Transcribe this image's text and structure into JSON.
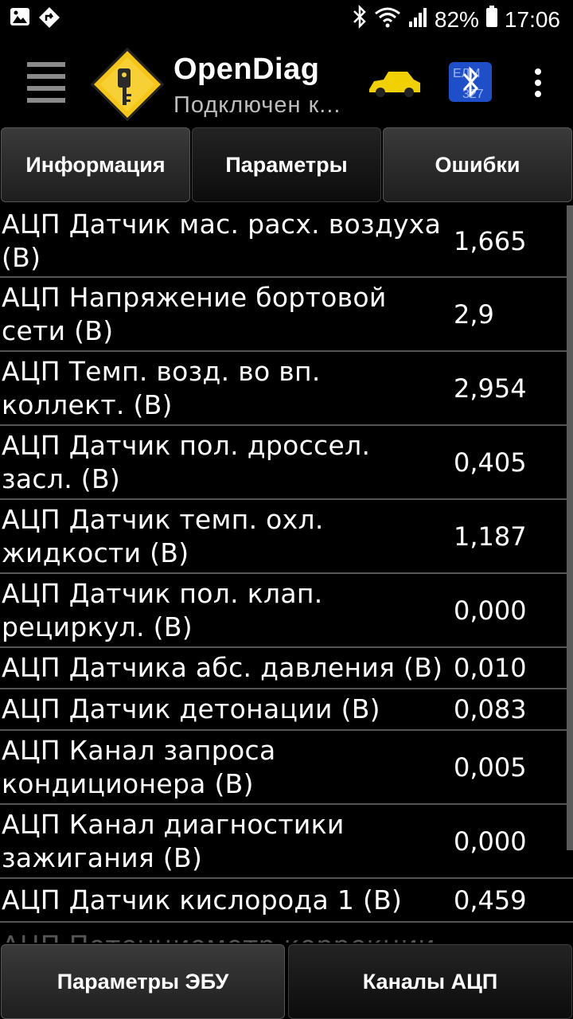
{
  "statusbar": {
    "battery": "82%",
    "time": "17:06",
    "icons": [
      "image-icon",
      "navigation-app-icon",
      "bluetooth-icon",
      "wifi-icon",
      "signal-icon",
      "battery-icon"
    ]
  },
  "appbar": {
    "title": "OpenDiag",
    "subtitle": "Подключен к...",
    "logo_color": "#f5c518",
    "car_color": "#f0d000",
    "bt_color": "#1e4fc8"
  },
  "tabs": [
    {
      "label": "Информация",
      "active": false
    },
    {
      "label": "Параметры",
      "active": true
    },
    {
      "label": "Ошибки",
      "active": false
    }
  ],
  "params": [
    {
      "label": "АЦП Датчик мас. расх. воздуха (В)",
      "value": "1,665"
    },
    {
      "label": "АЦП Напряжение бортовой сети (В)",
      "value": "2,9"
    },
    {
      "label": "АЦП Темп. возд. во вп. коллект. (В)",
      "value": "2,954"
    },
    {
      "label": "АЦП Датчик пол. дроссел. засл. (В)",
      "value": "0,405"
    },
    {
      "label": "АЦП Датчик темп. охл. жидкости (В)",
      "value": "1,187"
    },
    {
      "label": "АЦП Датчик пол. клап. рециркул. (В)",
      "value": "0,000"
    },
    {
      "label": "АЦП Датчика абс. давления (В)",
      "value": "0,010"
    },
    {
      "label": "АЦП Датчик детонации (В)",
      "value": "0,083"
    },
    {
      "label": "АЦП Канал запроса кондиционера (В)",
      "value": "0,005"
    },
    {
      "label": "АЦП Канал диагностики зажигания (В)",
      "value": "0,000"
    },
    {
      "label": "АЦП Датчик кислорода 1 (В)",
      "value": "0,459"
    },
    {
      "label": "АЦП Потенциометр коррекции",
      "value": ""
    }
  ],
  "bottom_buttons": [
    {
      "label": "Параметры ЭБУ",
      "active": false
    },
    {
      "label": "Каналы АЦП",
      "active": true
    }
  ]
}
